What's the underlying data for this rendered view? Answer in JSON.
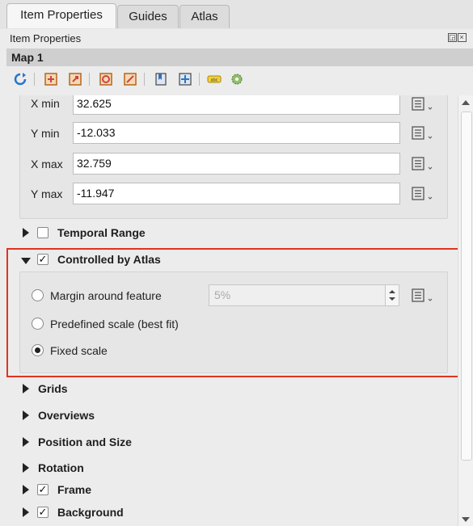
{
  "tabs": [
    {
      "label": "Item Properties",
      "active": true
    },
    {
      "label": "Guides",
      "active": false
    },
    {
      "label": "Atlas",
      "active": false
    }
  ],
  "panel_title": "Item Properties",
  "map_name": "Map 1",
  "extent": {
    "xmin_label": "X min",
    "xmin_value": "32.625",
    "ymin_label": "Y min",
    "ymin_value": "-12.033",
    "xmax_label": "X max",
    "xmax_value": "32.759",
    "ymax_label": "Y max",
    "ymax_value": "-11.947"
  },
  "sections": {
    "temporal": {
      "label": "Temporal Range",
      "checked": false
    },
    "atlas": {
      "label": "Controlled by Atlas",
      "checked": true
    },
    "grids": {
      "label": "Grids"
    },
    "overviews": {
      "label": "Overviews"
    },
    "position": {
      "label": "Position and Size"
    },
    "rotation": {
      "label": "Rotation"
    },
    "frame": {
      "label": "Frame",
      "checked": true
    },
    "background": {
      "label": "Background",
      "checked": true
    }
  },
  "atlas_options": {
    "margin_label": "Margin around feature",
    "margin_value": "5%",
    "predefined_label": "Predefined scale (best fit)",
    "fixed_label": "Fixed scale",
    "selected": "fixed"
  },
  "checkmark": "✓",
  "colors": {
    "highlight": "#e0341e"
  }
}
